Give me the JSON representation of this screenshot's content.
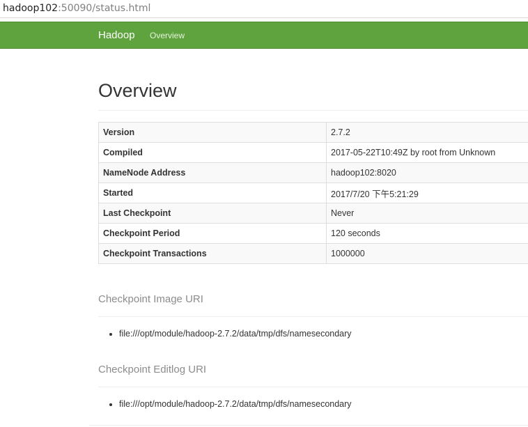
{
  "browser": {
    "url_host": "hadoop102",
    "url_rest": ":50090/status.html"
  },
  "navbar": {
    "brand": "Hadoop",
    "overview_link": "Overview",
    "background_color": "#5fa33e"
  },
  "main": {
    "title": "Overview",
    "info_rows": [
      {
        "key": "Version",
        "value": "2.7.2"
      },
      {
        "key": "Compiled",
        "value": "2017-05-22T10:49Z by root from Unknown"
      },
      {
        "key": "NameNode Address",
        "value": "hadoop102:8020"
      },
      {
        "key": "Started",
        "value": "2017/7/20 下午5:21:29"
      },
      {
        "key": "Last Checkpoint",
        "value": "Never"
      },
      {
        "key": "Checkpoint Period",
        "value": "120 seconds"
      },
      {
        "key": "Checkpoint Transactions",
        "value": "1000000"
      }
    ],
    "image_uri_heading": "Checkpoint Image URI",
    "image_uris": [
      "file:///opt/module/hadoop-2.7.2/data/tmp/dfs/namesecondary"
    ],
    "editlog_uri_heading": "Checkpoint Editlog URI",
    "editlog_uris": [
      "file:///opt/module/hadoop-2.7.2/data/tmp/dfs/namesecondary"
    ]
  }
}
